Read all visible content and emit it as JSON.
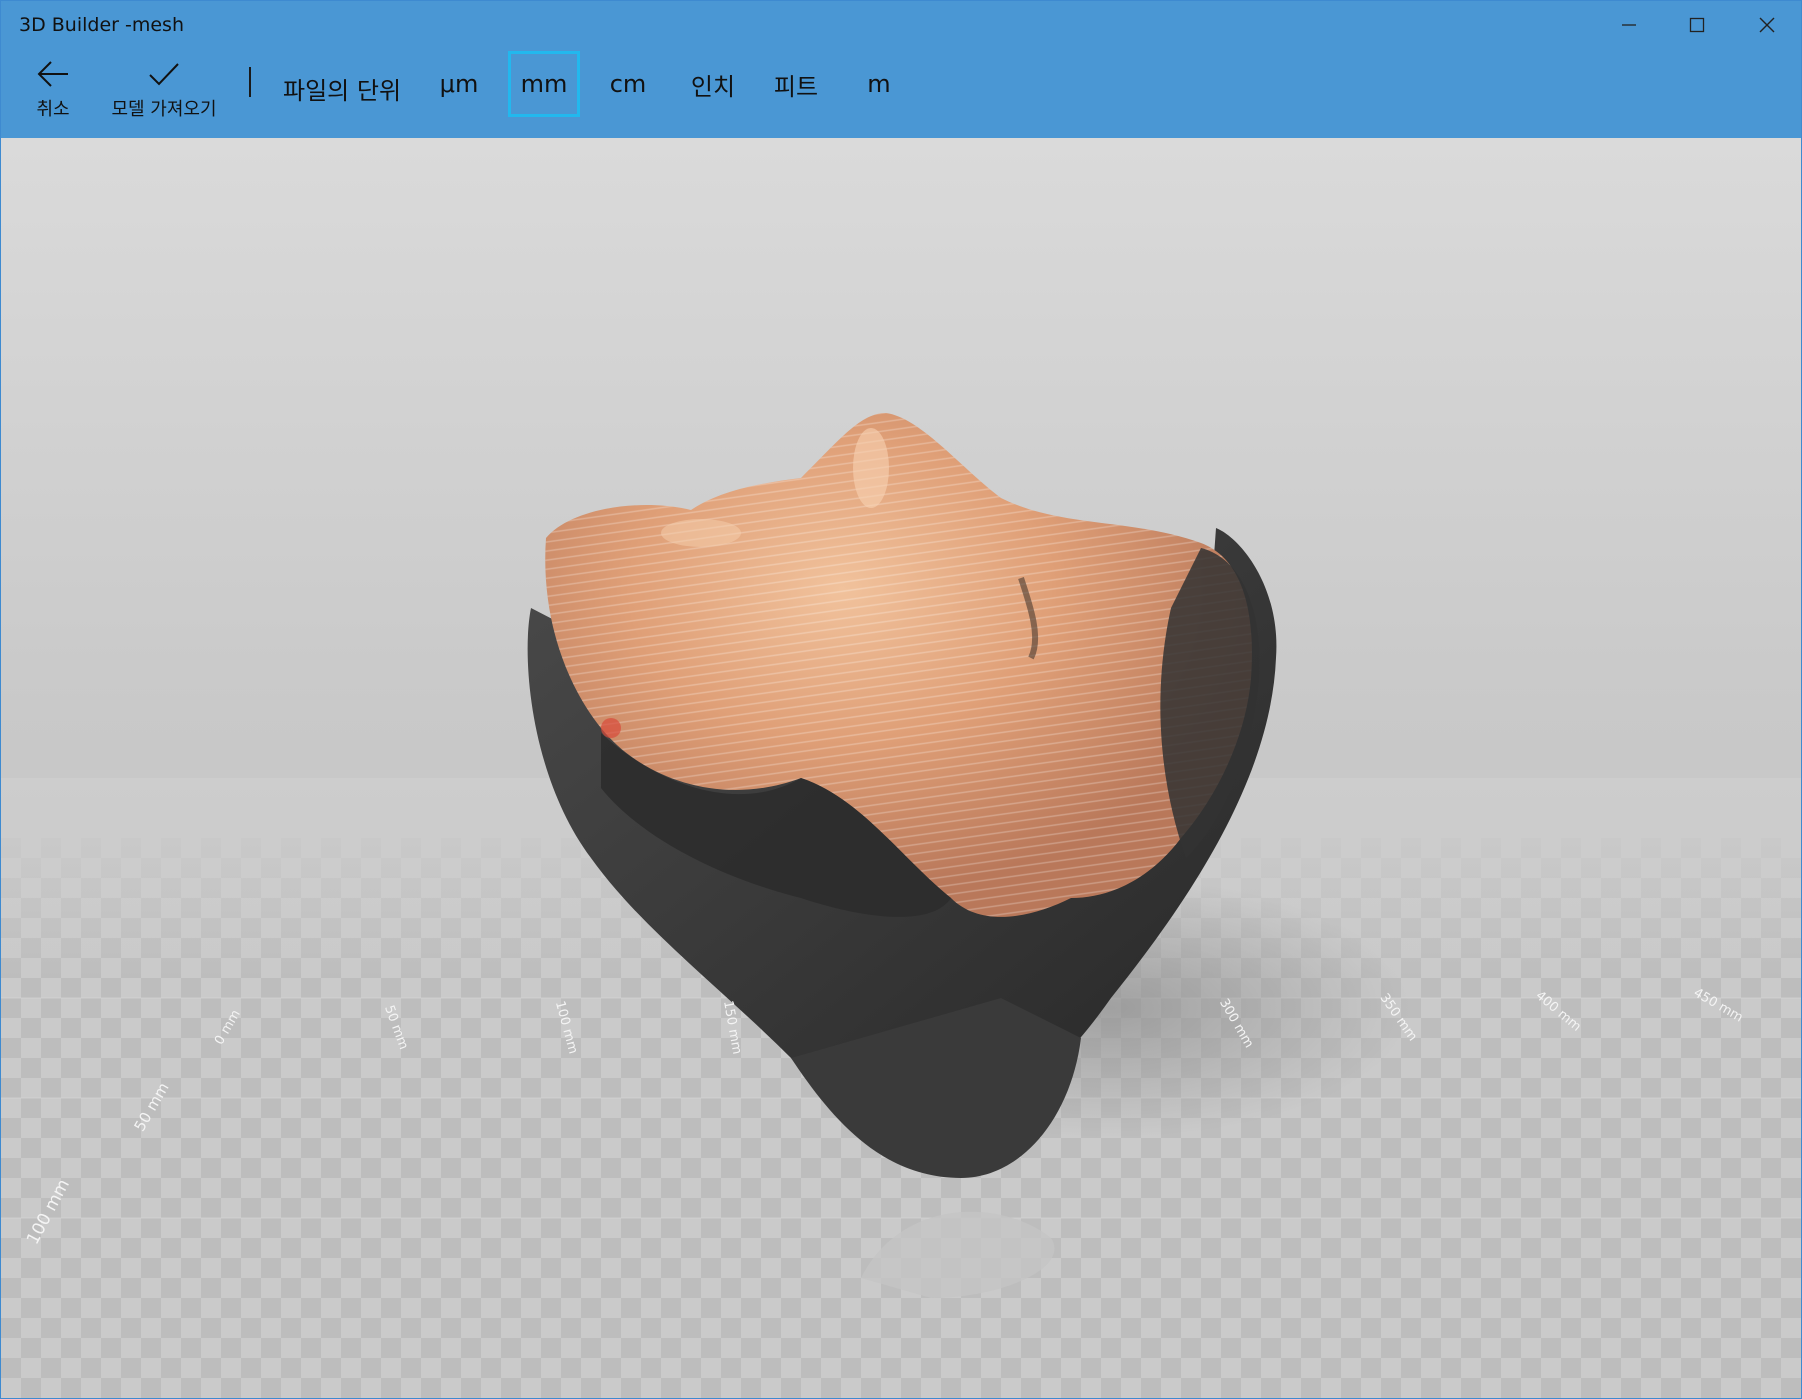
{
  "window": {
    "title": "3D Builder -mesh"
  },
  "toolbar": {
    "cancel_label": "취소",
    "import_label": "모델 가져오기",
    "units_label": "파일의 단위",
    "units": [
      "μm",
      "mm",
      "cm",
      "인치",
      "피트",
      "m"
    ],
    "selected_unit": "mm"
  },
  "ruler": {
    "x_labels": [
      "0 mm",
      "50 mm",
      "100 mm",
      "150 mm",
      "300 mm",
      "350 mm",
      "400 mm",
      "450 mm"
    ],
    "z_labels": [
      "50 mm",
      "100 mm"
    ]
  },
  "colors": {
    "titlebar": "#4a97d4",
    "selection_border": "#22b8ee",
    "viewport": "#c8c8c8"
  }
}
